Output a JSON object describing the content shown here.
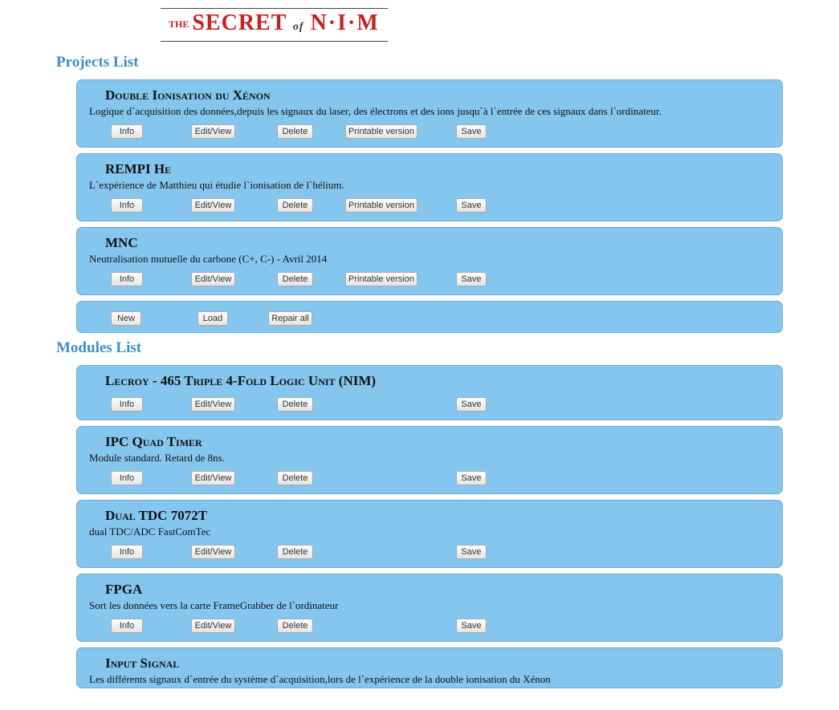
{
  "logo": {
    "the": "THE",
    "secret": "SECRET",
    "of": "of",
    "nim": "N·I·M"
  },
  "sections": {
    "projects_title": "Projects List",
    "modules_title": "Modules List"
  },
  "buttons": {
    "info": "Info",
    "edit": "Edit/View",
    "delete": "Delete",
    "print": "Printable version",
    "save": "Save",
    "new": "New",
    "load": "Load",
    "repair": "Repair all"
  },
  "projects": [
    {
      "title": "Double Ionisation du Xénon",
      "desc": "Logique d`acquisition des données,depuis les signaux du laser, des électrons et des ions jusqu`à l`entrée de ces signaux dans l`ordinateur."
    },
    {
      "title": "REMPI He",
      "desc": "L`expérience de Matthieu qui étudie l`ionisation de l`hélium."
    },
    {
      "title": "MNC",
      "desc": "Neutralisation mutuelle du carbone (C+, C-) - Avril 2014"
    }
  ],
  "modules": [
    {
      "title": "Lecroy - 465 Triple 4-Fold Logic Unit (NIM)",
      "desc": ""
    },
    {
      "title": "IPC Quad Timer",
      "desc": "Module standard. Retard de 8ns."
    },
    {
      "title": "Dual TDC 7072T",
      "desc": "dual TDC/ADC FastComTec"
    },
    {
      "title": "FPGA",
      "desc": "Sort les données vers la carte FrameGrabber de l`ordinateur"
    },
    {
      "title": "Input Signal",
      "desc": "Les différents signaux d`entrée du système d`acquisition,lors de l`expérience de la double ionisation du Xénon"
    }
  ]
}
